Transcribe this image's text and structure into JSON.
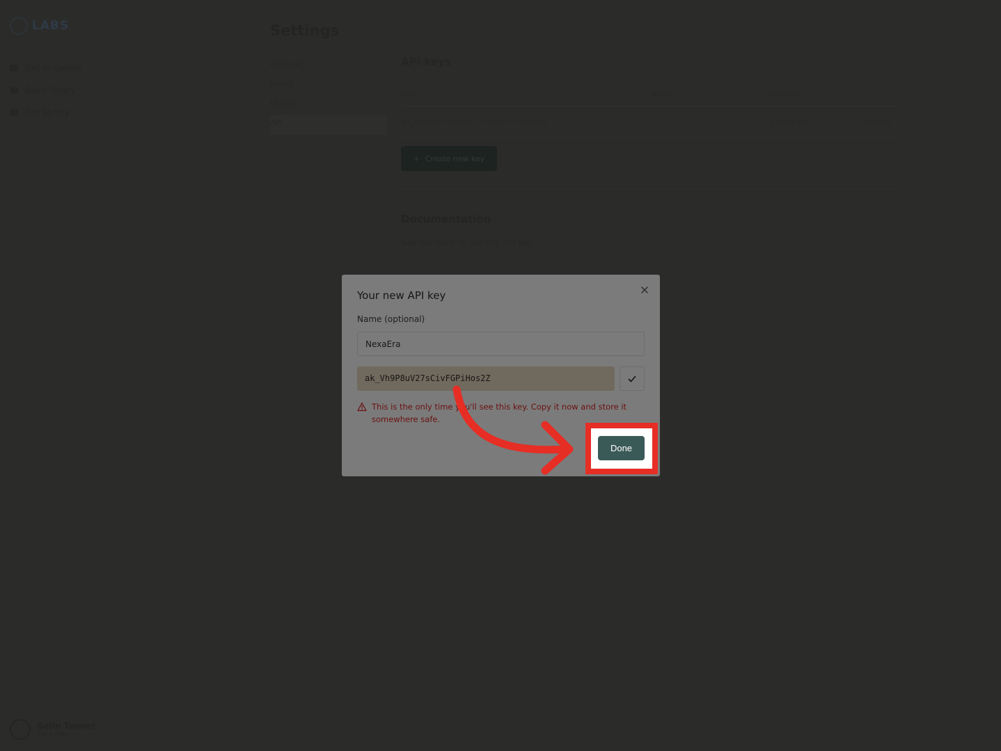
{
  "app": {
    "logo_text": "LABS",
    "nav": [
      {
        "label": "Get to gallery"
      },
      {
        "label": "Build library"
      },
      {
        "label": "Get library"
      }
    ],
    "profile": {
      "name": "Selin Tanner",
      "subtitle": "Free plan"
    }
  },
  "settings": {
    "title": "Settings",
    "nav": [
      {
        "label": "Account"
      },
      {
        "label": "Billing"
      },
      {
        "label": "Usage"
      },
      {
        "label": "API"
      }
    ],
    "api_section": {
      "heading": "API keys",
      "columns": [
        "Key",
        "Name",
        "Created",
        ""
      ],
      "rows": [
        {
          "key": "ak_Bl9M•••••••••••••••••••••bxkd",
          "name": "",
          "created": "2 days ago",
          "action": "Revoke"
        }
      ],
      "create_label": "Create new key"
    },
    "documentation": {
      "heading": "Documentation",
      "text": "See our docs to use the API key"
    }
  },
  "modal": {
    "title": "Your new API key",
    "name_label": "Name (optional)",
    "name_value": "NexaEra",
    "api_key": "ak_Vh9P8uV27sCivFGPiHos2Z",
    "warning": "This is the only time you'll see this key. Copy it now and store it somewhere safe.",
    "done_label": "Done"
  },
  "colors": {
    "annotation": "#e62e25",
    "done_button": "#3a5a58",
    "warning_text": "#6b1010"
  },
  "icons": [
    "close-icon",
    "check-icon",
    "warning-icon",
    "annotation-arrow"
  ]
}
